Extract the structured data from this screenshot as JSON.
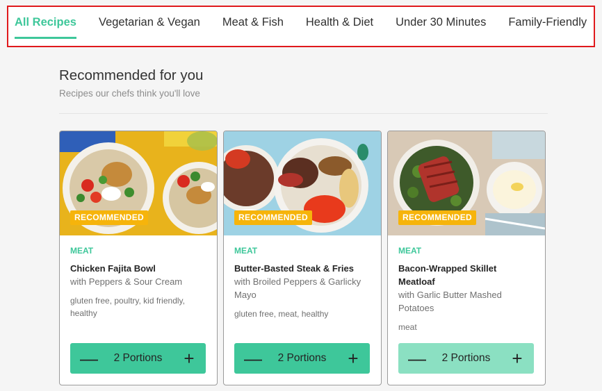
{
  "tabs": [
    {
      "label": "All Recipes",
      "active": true
    },
    {
      "label": "Vegetarian & Vegan",
      "active": false
    },
    {
      "label": "Meat & Fish",
      "active": false
    },
    {
      "label": "Health & Diet",
      "active": false
    },
    {
      "label": "Under 30 Minutes",
      "active": false
    },
    {
      "label": "Family-Friendly",
      "active": false
    }
  ],
  "section": {
    "title": "Recommended for you",
    "subtitle": "Recipes our chefs think you'll love"
  },
  "cards": [
    {
      "badge": "RECOMMENDED",
      "category": "MEAT",
      "title": "Chicken Fajita Bowl",
      "subtitle": "with Peppers & Sour Cream",
      "tags": "gluten free, poultry, kid friendly, healthy",
      "portions": "2 Portions",
      "minus": "—",
      "plus": "+"
    },
    {
      "badge": "RECOMMENDED",
      "category": "MEAT",
      "title": "Butter-Basted Steak & Fries",
      "subtitle": "with Broiled Peppers & Garlicky Mayo",
      "tags": "gluten free, meat, healthy",
      "portions": "2 Portions",
      "minus": "—",
      "plus": "+"
    },
    {
      "badge": "RECOMMENDED",
      "category": "MEAT",
      "title": "Bacon-Wrapped Skillet Meatloaf",
      "subtitle": "with Garlic Butter Mashed Potatoes",
      "tags": "meat",
      "portions": "2 Portions",
      "minus": "—",
      "plus": "+"
    }
  ],
  "colors": {
    "accent": "#3ec79a",
    "badge": "#f6b40b",
    "highlight_border": "#e0191c"
  }
}
